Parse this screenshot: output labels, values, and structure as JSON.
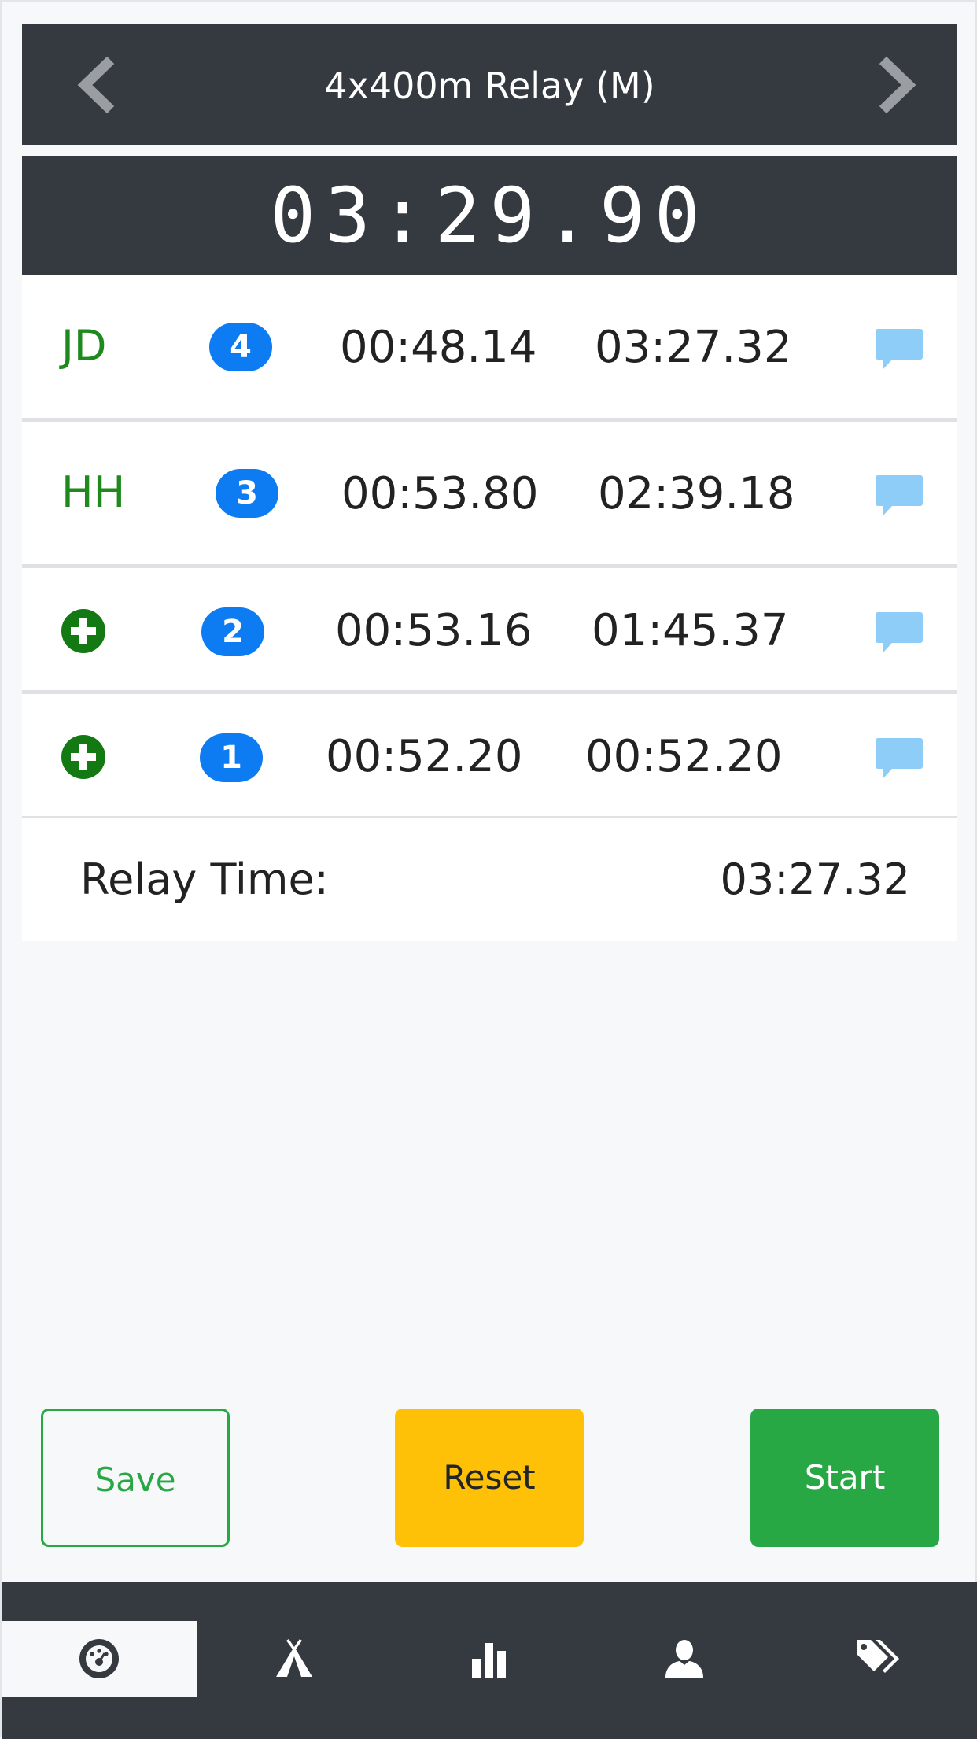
{
  "header": {
    "title": "4x400m Relay (M)",
    "prev_icon": "chevron-left-icon",
    "next_icon": "chevron-right-icon"
  },
  "timer": {
    "display": "03:29.90"
  },
  "splits": [
    {
      "runner": "JD",
      "leg": "4",
      "split": "00:48.14",
      "cumulative": "03:27.32"
    },
    {
      "runner": "HH",
      "leg": "3",
      "split": "00:53.80",
      "cumulative": "02:39.18"
    },
    {
      "runner": "",
      "leg": "2",
      "split": "00:53.16",
      "cumulative": "01:45.37"
    },
    {
      "runner": "",
      "leg": "1",
      "split": "00:52.20",
      "cumulative": "00:52.20"
    }
  ],
  "relay": {
    "label": "Relay Time:",
    "value": "03:27.32"
  },
  "actions": {
    "save_label": "Save",
    "reset_label": "Reset",
    "start_label": "Start"
  },
  "tabs": [
    {
      "icon": "stopwatch-icon",
      "active": true
    },
    {
      "icon": "tent-icon",
      "active": false
    },
    {
      "icon": "bar-chart-icon",
      "active": false
    },
    {
      "icon": "user-icon",
      "active": false
    },
    {
      "icon": "tags-icon",
      "active": false
    }
  ],
  "colors": {
    "dark": "#343a40",
    "runner_green": "#1e8a1e",
    "leg_badge_blue": "#0d7bf2",
    "comment_blue": "#8ecdf7",
    "save_green": "#28a745",
    "reset_yellow": "#ffc107",
    "start_green": "#28a745"
  }
}
